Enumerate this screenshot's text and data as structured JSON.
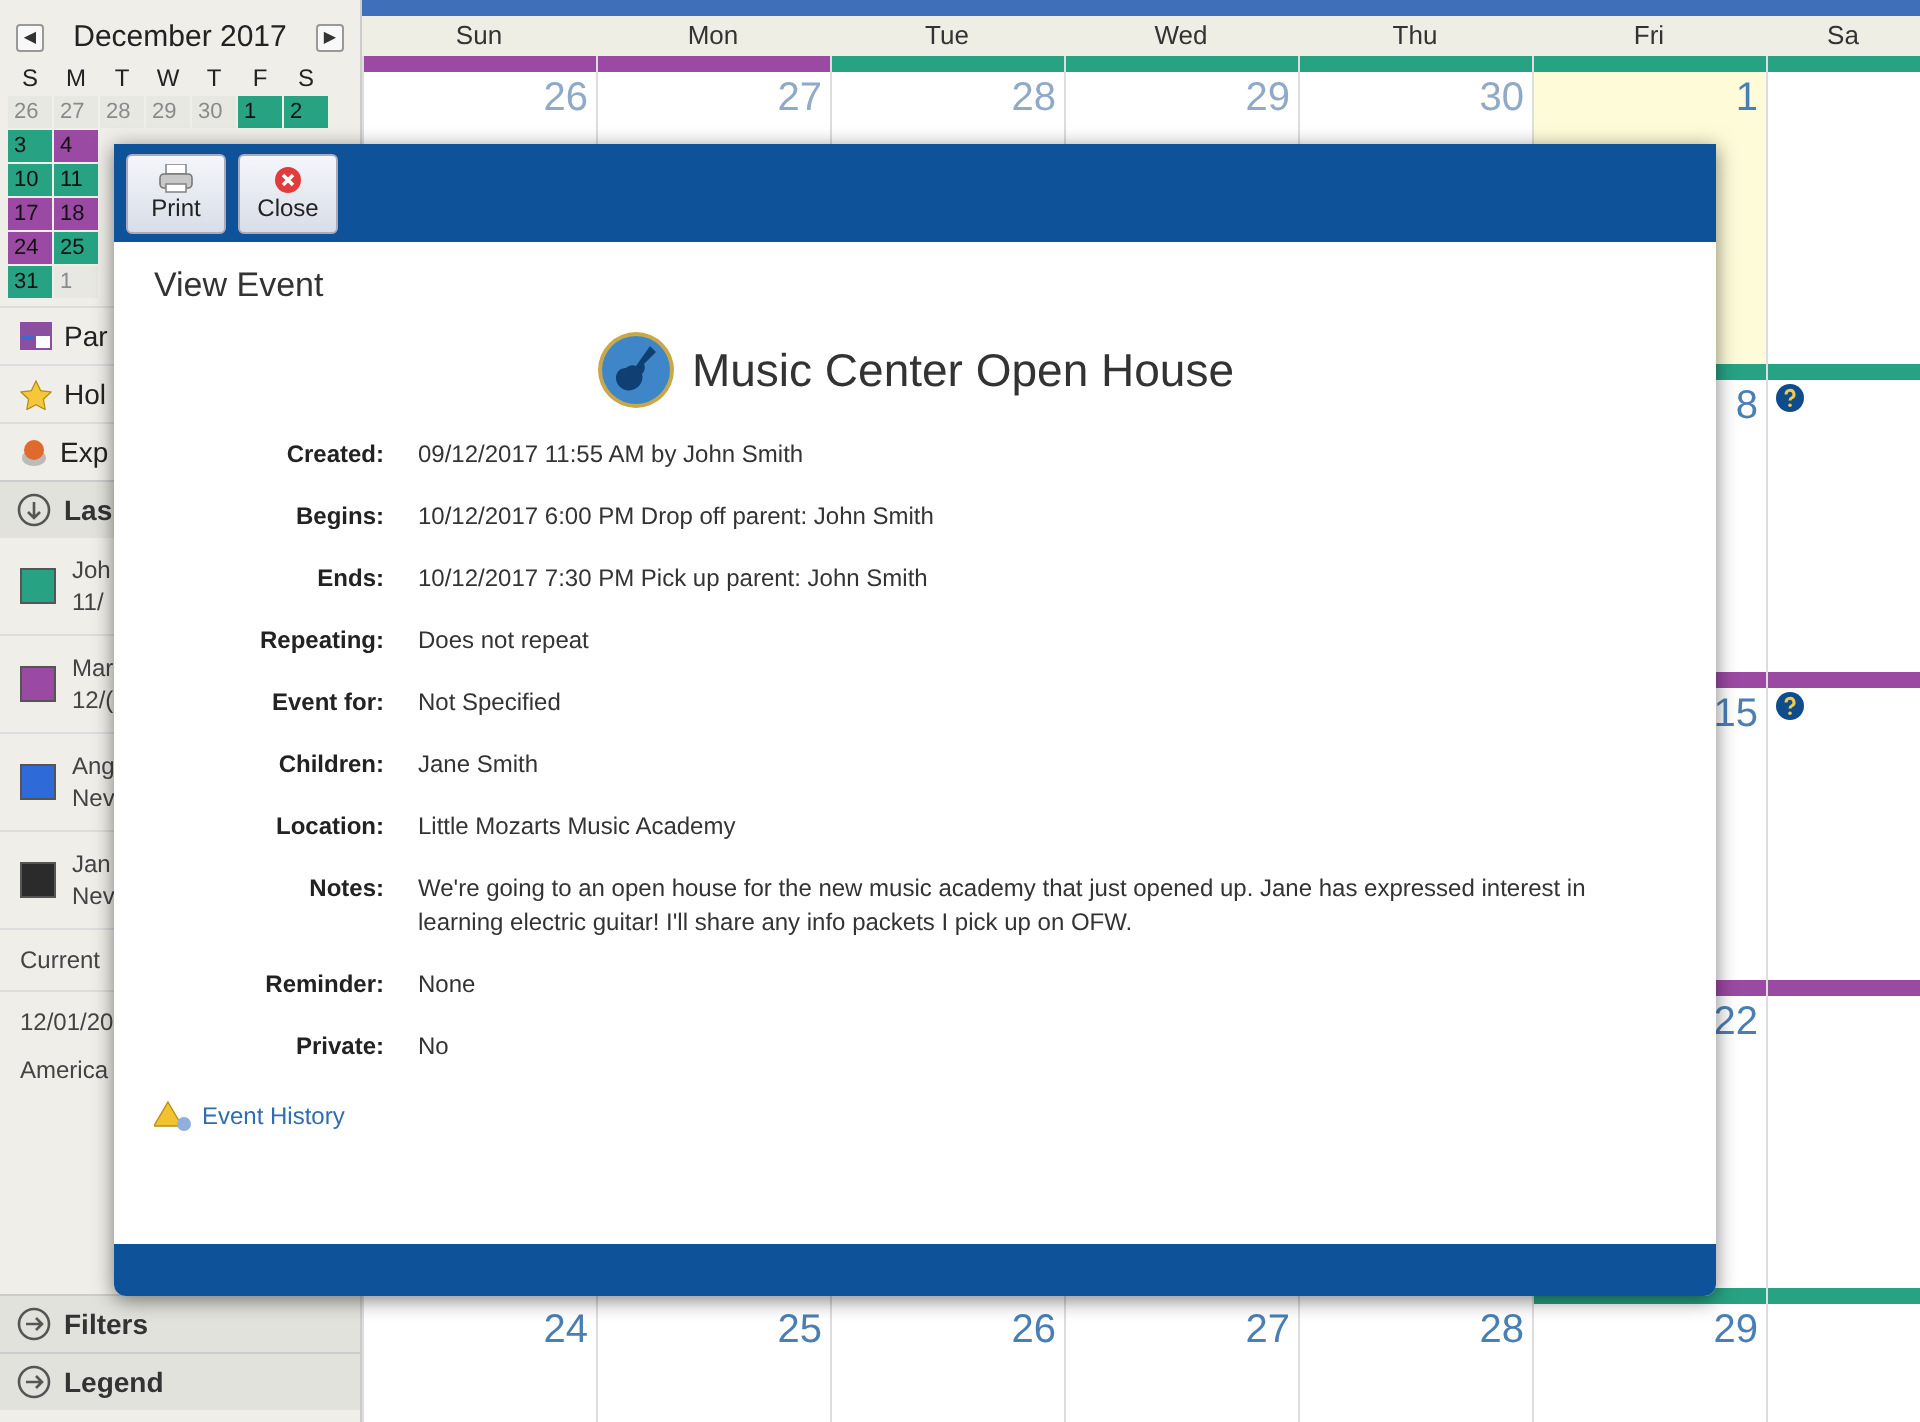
{
  "mini_calendar": {
    "title": "December 2017",
    "prev": "◀",
    "next": "▶",
    "weekdays": [
      "S",
      "M",
      "T",
      "W",
      "T",
      "F",
      "S"
    ],
    "rows": [
      [
        {
          "day": "26",
          "muted": true,
          "color": "#e8e8e2"
        },
        {
          "day": "27",
          "muted": true,
          "color": "#e8e8e2"
        },
        {
          "day": "28",
          "muted": true,
          "color": "#e8e8e2"
        },
        {
          "day": "29",
          "muted": true,
          "color": "#e8e8e2"
        },
        {
          "day": "30",
          "muted": true,
          "color": "#e8e8e2"
        },
        {
          "day": "1",
          "muted": false,
          "color": "#27a383"
        },
        {
          "day": "2",
          "muted": false,
          "color": "#27a383"
        }
      ],
      [
        {
          "day": "3",
          "muted": false,
          "color": "#27a383"
        },
        {
          "day": "4",
          "muted": false,
          "color": "#9b4aa3"
        }
      ],
      [
        {
          "day": "10",
          "muted": false,
          "color": "#27a383"
        },
        {
          "day": "11",
          "muted": false,
          "color": "#27a383"
        }
      ],
      [
        {
          "day": "17",
          "muted": false,
          "color": "#9b4aa3"
        },
        {
          "day": "18",
          "muted": false,
          "color": "#9b4aa3"
        }
      ],
      [
        {
          "day": "24",
          "muted": false,
          "color": "#9b4aa3"
        },
        {
          "day": "25",
          "muted": false,
          "color": "#27a383"
        }
      ],
      [
        {
          "day": "31",
          "muted": false,
          "color": "#27a383"
        },
        {
          "day": "1",
          "muted": true,
          "color": "#e8e8e2"
        }
      ]
    ]
  },
  "sidebar_links": [
    {
      "kind": "calendar",
      "label": "Par"
    },
    {
      "kind": "star",
      "label": "Hol"
    },
    {
      "kind": "pie",
      "label": "Exp"
    }
  ],
  "last_section": {
    "label": "Las",
    "expanded": true
  },
  "parents": [
    {
      "name": "Joh",
      "date": "11/",
      "color": "#27a383"
    },
    {
      "name": "Mar",
      "date": "12/(",
      "color": "#9b4aa3"
    },
    {
      "name": "Ang",
      "date": "Nev",
      "color": "#2f6bd8"
    },
    {
      "name": "Jan",
      "date": "Nev",
      "color": "#2b2b2b"
    }
  ],
  "current": {
    "label": "Current",
    "date": "12/01/20",
    "zone": "America"
  },
  "bottom_sections": [
    {
      "label": "Filters",
      "expanded": false
    },
    {
      "label": "Legend",
      "expanded": false
    }
  ],
  "calendar": {
    "days": [
      "Sun",
      "Mon",
      "Tue",
      "Wed",
      "Thu",
      "Fri",
      "Sa"
    ],
    "weeks": [
      {
        "cells": [
          {
            "day": "26",
            "muted": true,
            "color": "#9b4aa3"
          },
          {
            "day": "27",
            "muted": true,
            "color": "#9b4aa3"
          },
          {
            "day": "28",
            "muted": true,
            "color": "#27a383"
          },
          {
            "day": "29",
            "muted": true,
            "color": "#27a383"
          },
          {
            "day": "30",
            "muted": true,
            "color": "#27a383"
          },
          {
            "day": "1",
            "muted": false,
            "today": true,
            "color": "#27a383"
          },
          {
            "color": "#27a383"
          }
        ]
      },
      {
        "cells": [
          {
            "day": "8",
            "muted": false,
            "today": false,
            "color": "#27a383"
          },
          {
            "help": true,
            "color": "#27a383"
          }
        ]
      },
      {
        "cells": [
          {
            "day": "15",
            "muted": false,
            "today": false,
            "color": "#9b4aa3"
          },
          {
            "help": true,
            "color": "#9b4aa3"
          }
        ]
      },
      {
        "cells": [
          {
            "day": "22",
            "muted": false,
            "today": false,
            "color": "#9b4aa3"
          },
          {
            "color": "#9b4aa3"
          }
        ]
      },
      {
        "cells": [
          {
            "day": "24",
            "muted": false
          },
          {
            "day": "25",
            "muted": false
          },
          {
            "day": "26",
            "muted": false
          },
          {
            "day": "27",
            "muted": false
          },
          {
            "day": "28",
            "muted": false
          },
          {
            "day": "29",
            "muted": false,
            "color": "#27a383"
          },
          {
            "color": "#27a383"
          }
        ]
      }
    ]
  },
  "modal": {
    "buttons": [
      {
        "kind": "print",
        "label": "Print"
      },
      {
        "kind": "close",
        "label": "Close"
      }
    ],
    "heading": "View Event",
    "title": "Music Center Open House",
    "fields": [
      {
        "label": "Created:",
        "value": "09/12/2017 11:55 AM by John Smith"
      },
      {
        "label": "Begins:",
        "value": "10/12/2017 6:00 PM Drop off parent: John Smith"
      },
      {
        "label": "Ends:",
        "value": "10/12/2017 7:30 PM Pick up parent: John Smith"
      },
      {
        "label": "Repeating:",
        "value": "Does not repeat"
      },
      {
        "label": "Event for:",
        "value": "Not Specified"
      },
      {
        "label": "Children:",
        "value": "Jane Smith"
      },
      {
        "label": "Location:",
        "value": "Little Mozarts Music Academy"
      },
      {
        "label": "Notes:",
        "value": "We're going to an open house for the new music academy that just opened up. Jane has expressed interest in learning electric guitar! I'll share any info packets I pick up on OFW."
      },
      {
        "label": "Reminder:",
        "value": "None"
      },
      {
        "label": "Private:",
        "value": "No"
      }
    ],
    "history_link": "Event History"
  }
}
